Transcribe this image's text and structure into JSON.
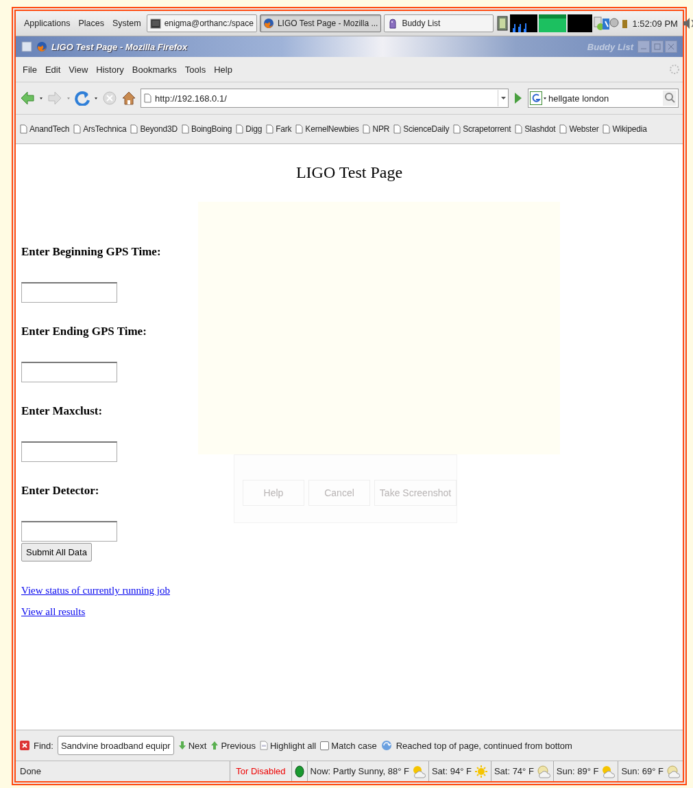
{
  "top_panel": {
    "menus": [
      "Applications",
      "Places",
      "System"
    ],
    "tasks": [
      {
        "label": "enigma@orthanc:/space",
        "kind": "terminal",
        "selected": false
      },
      {
        "label": "LIGO Test Page - Mozilla ...",
        "kind": "browser",
        "selected": true
      },
      {
        "label": "Buddy List",
        "kind": "chat",
        "selected": false
      }
    ],
    "clock": "1:52:09 PM"
  },
  "window": {
    "title": "LIGO Test Page - Mozilla Firefox",
    "behind_title": "Buddy List"
  },
  "menu_bar": [
    "File",
    "Edit",
    "View",
    "History",
    "Bookmarks",
    "Tools",
    "Help"
  ],
  "nav_bar": {
    "url": "http://192.168.0.1/",
    "search": "hellgate london"
  },
  "bookmarks": [
    "AnandTech",
    "ArsTechnica",
    "Beyond3D",
    "BoingBoing",
    "Digg",
    "Fark",
    "KernelNewbies",
    "NPR",
    "ScienceDaily",
    "Scrapetorrent",
    "Slashdot",
    "Webster",
    "Wikipedia"
  ],
  "page": {
    "title": "LIGO Test Page",
    "fields": [
      {
        "label": "Enter Beginning GPS Time:"
      },
      {
        "label": "Enter Ending GPS Time:"
      },
      {
        "label": "Enter Maxclust:"
      },
      {
        "label": "Enter Detector:"
      }
    ],
    "submit": "Submit All Data",
    "links": [
      "View status of currently running job",
      "View all results"
    ]
  },
  "ghost_dialog": {
    "buttons": [
      "Help",
      "Cancel",
      "Take Screenshot"
    ]
  },
  "find_bar": {
    "label": "Find:",
    "value": "Sandvine broadband equipr",
    "next": "Next",
    "previous": "Previous",
    "highlight": "Highlight all",
    "match_case": {
      "label": "Match case",
      "checked": false
    },
    "message": "Reached top of page, continued from bottom"
  },
  "status_bar": {
    "status": "Done",
    "tor": "Tor Disabled",
    "weather": [
      {
        "text": "Now: Partly Sunny, 88° F",
        "kind": "partly-sunny"
      },
      {
        "text": "Sat: 94° F",
        "kind": "sunny"
      },
      {
        "text": "Sat: 74° F",
        "kind": "night-cloudy"
      },
      {
        "text": "Sun: 89° F",
        "kind": "partly-sunny"
      },
      {
        "text": "Sun: 69° F",
        "kind": "night-cloudy"
      }
    ]
  }
}
